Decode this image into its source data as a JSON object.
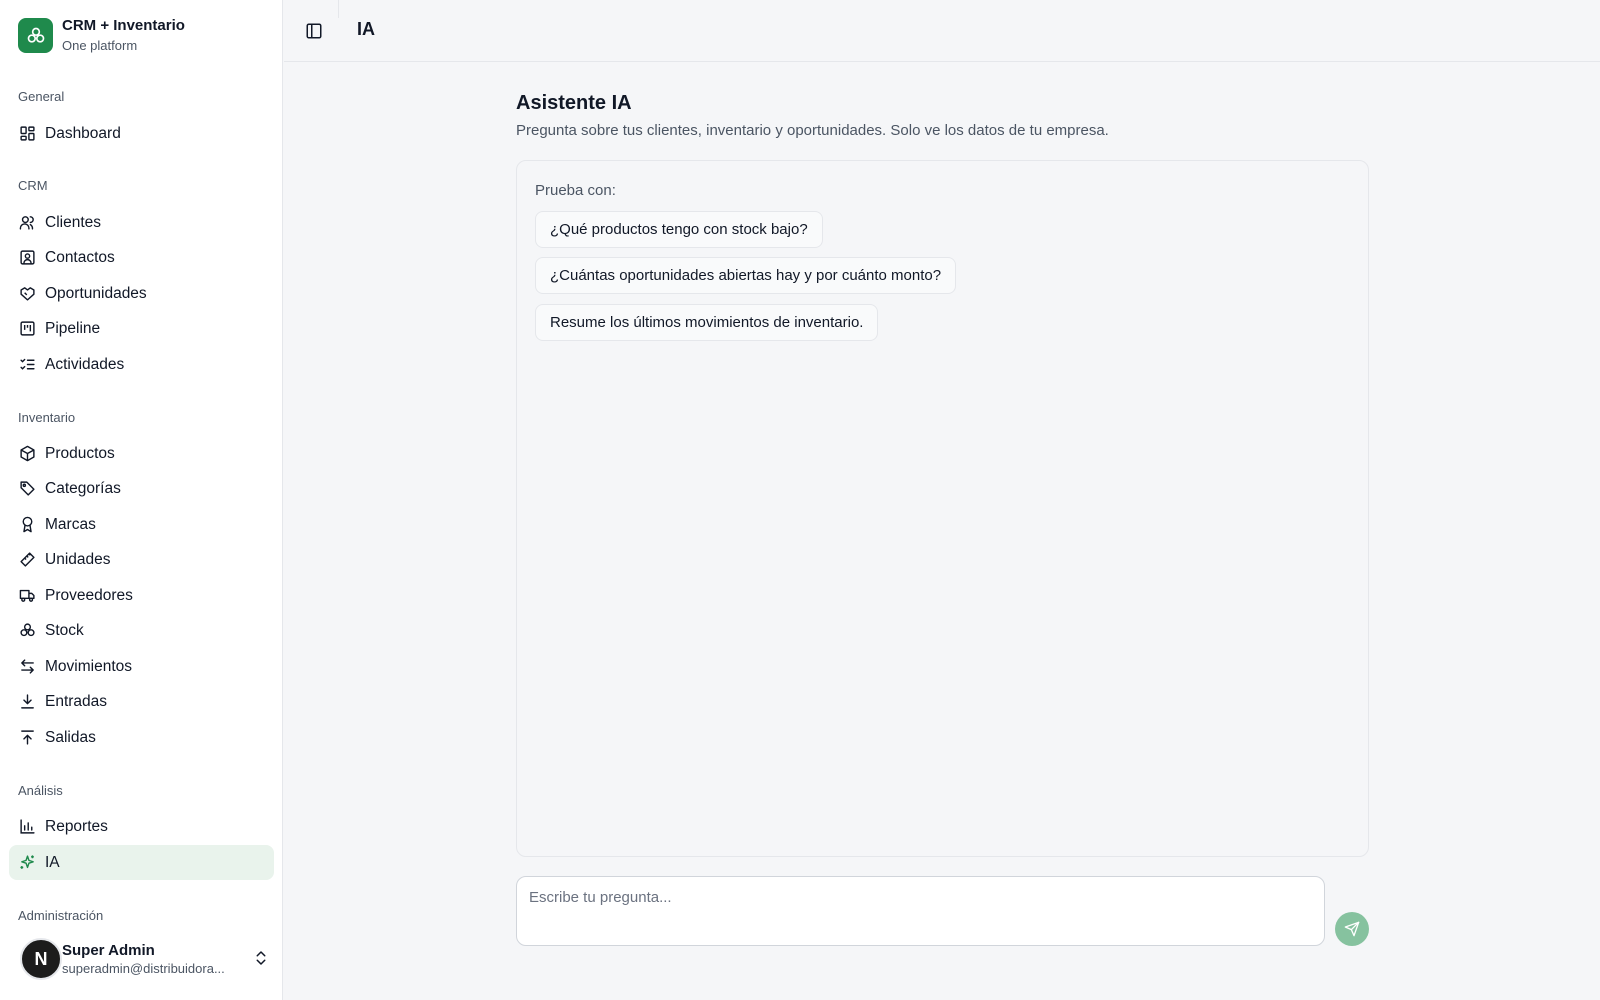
{
  "brand": {
    "name": "CRM + Inventario",
    "subtitle": "One platform",
    "logo_icon": "boxes-icon",
    "accent": "#1f8a4c"
  },
  "sidebar": {
    "sections": [
      {
        "label": "General",
        "items": [
          {
            "label": "Dashboard",
            "icon": "dashboard-icon"
          }
        ]
      },
      {
        "label": "CRM",
        "items": [
          {
            "label": "Clientes",
            "icon": "users-icon"
          },
          {
            "label": "Contactos",
            "icon": "contact-icon"
          },
          {
            "label": "Oportunidades",
            "icon": "handshake-icon"
          },
          {
            "label": "Pipeline",
            "icon": "kanban-icon"
          },
          {
            "label": "Actividades",
            "icon": "list-checks-icon"
          }
        ]
      },
      {
        "label": "Inventario",
        "items": [
          {
            "label": "Productos",
            "icon": "package-icon"
          },
          {
            "label": "Categorías",
            "icon": "tags-icon"
          },
          {
            "label": "Marcas",
            "icon": "award-icon"
          },
          {
            "label": "Unidades",
            "icon": "ruler-icon"
          },
          {
            "label": "Proveedores",
            "icon": "truck-icon"
          },
          {
            "label": "Stock",
            "icon": "boxes-icon"
          },
          {
            "label": "Movimientos",
            "icon": "arrows-left-right-icon"
          },
          {
            "label": "Entradas",
            "icon": "download-icon"
          },
          {
            "label": "Salidas",
            "icon": "upload-icon"
          }
        ]
      },
      {
        "label": "Análisis",
        "items": [
          {
            "label": "Reportes",
            "icon": "bar-chart-icon"
          },
          {
            "label": "IA",
            "icon": "sparkles-icon",
            "active": true
          }
        ]
      },
      {
        "label": "Administración",
        "items": []
      }
    ]
  },
  "user": {
    "avatar_letter": "N",
    "name": "Super Admin",
    "email": "superadmin@distribuidora..."
  },
  "header": {
    "title": "IA"
  },
  "main": {
    "title": "Asistente IA",
    "subtitle": "Pregunta sobre tus clientes, inventario y oportunidades. Solo ve los datos de tu empresa.",
    "try_label": "Prueba con:",
    "suggestions": [
      "¿Qué productos tengo con stock bajo?",
      "¿Cuántas oportunidades abiertas hay y por cuánto monto?",
      "Resume los últimos movimientos de inventario."
    ],
    "input_placeholder": "Escribe tu pregunta..."
  }
}
